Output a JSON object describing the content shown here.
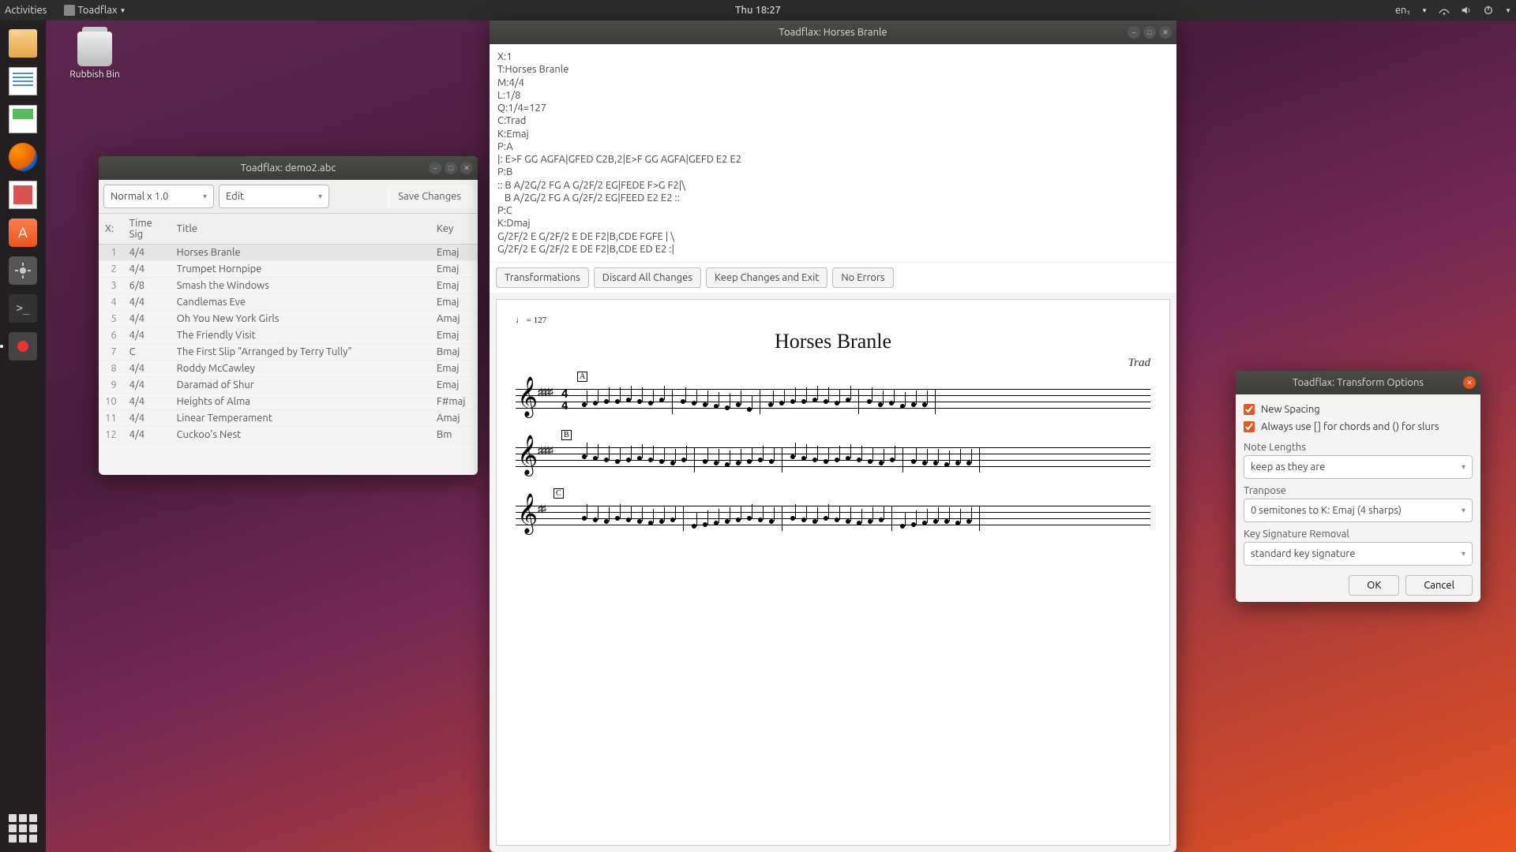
{
  "topbar": {
    "activities": "Activities",
    "appname": "Toadflax",
    "clock": "Thu 18:27",
    "lang": "en₁"
  },
  "desktop": {
    "trash_label": "Rubbish Bin"
  },
  "list_window": {
    "title": "Toadflax: demo2.abc",
    "zoom_label": "Normal x 1.0",
    "mode_label": "Edit",
    "save_label": "Save Changes",
    "columns": {
      "x": "X:",
      "timesig": "Time Sig",
      "title": "Title",
      "key": "Key"
    },
    "rows": [
      {
        "x": "1",
        "ts": "4/4",
        "title": "Horses Branle",
        "key": "Emaj",
        "sel": true
      },
      {
        "x": "2",
        "ts": "4/4",
        "title": "Trumpet Hornpipe",
        "key": "Emaj"
      },
      {
        "x": "3",
        "ts": "6/8",
        "title": "Smash the Windows",
        "key": "Emaj"
      },
      {
        "x": "4",
        "ts": "4/4",
        "title": "Candlemas Eve",
        "key": "Emaj"
      },
      {
        "x": "5",
        "ts": "4/4",
        "title": "Oh You New York Girls",
        "key": "Amaj"
      },
      {
        "x": "6",
        "ts": "4/4",
        "title": "The Friendly Visit",
        "key": "Emaj"
      },
      {
        "x": "7",
        "ts": "C",
        "title": "The First Slip  \"Arranged by Terry Tully\"",
        "key": "Bmaj"
      },
      {
        "x": "8",
        "ts": "4/4",
        "title": "Roddy McCawley",
        "key": "Emaj"
      },
      {
        "x": "9",
        "ts": "4/4",
        "title": "Daramad of Shur",
        "key": "Emaj"
      },
      {
        "x": "10",
        "ts": "4/4",
        "title": "Heights of Alma",
        "key": "F#maj"
      },
      {
        "x": "11",
        "ts": "4/4",
        "title": "Linear Temperament",
        "key": "Amaj"
      },
      {
        "x": "12",
        "ts": "4/4",
        "title": "Cuckoo's Nest",
        "key": "Bm"
      }
    ]
  },
  "editor_window": {
    "title": "Toadflax: Horses Branle",
    "abc_source": "X:1\nT:Horses Branle\nM:4/4\nL:1/8\nQ:1/4=127\nC:Trad\nK:Emaj\nP:A\n|: E>F GG AGFA|GFED C2B,2|E>F GG AGFA|GEFD E2 E2\nP:B\n:: B A/2G/2 FG A G/2F/2 EG|FEDE F>G F2|\\\n   B A/2G/2 FG A G/2F/2 EG|FEED E2 E2 ::\nP:C\nK:Dmaj\nG/2F/2 E G/2F/2 E DE F2|B,CDE FGFE | \\\nG/2F/2 E G/2F/2 E DE F2|B,CDE ED E2 :|",
    "buttons": {
      "transform": "Transformations",
      "discard": "Discard All Changes",
      "keep": "Keep Changes and Exit",
      "errors": "No Errors"
    },
    "score": {
      "tempo": "♩ = 127",
      "title": "Horses Branle",
      "composer": "Trad",
      "time_num": "4",
      "time_den": "4",
      "rehA": "A",
      "rehB": "B",
      "rehC": "C"
    }
  },
  "transform_dialog": {
    "title": "Toadflax: Transform Options",
    "new_spacing": "New Spacing",
    "always_brackets": "Always use [] for chords and () for slurs",
    "note_lengths_label": "Note Lengths",
    "note_lengths_value": "keep as they are",
    "transpose_label": "Tranpose",
    "transpose_value": "0 semitones to K: Emaj (4 sharps)",
    "keysig_label": "Key Signature Removal",
    "keysig_value": "standard key signature",
    "ok": "OK",
    "cancel": "Cancel"
  }
}
